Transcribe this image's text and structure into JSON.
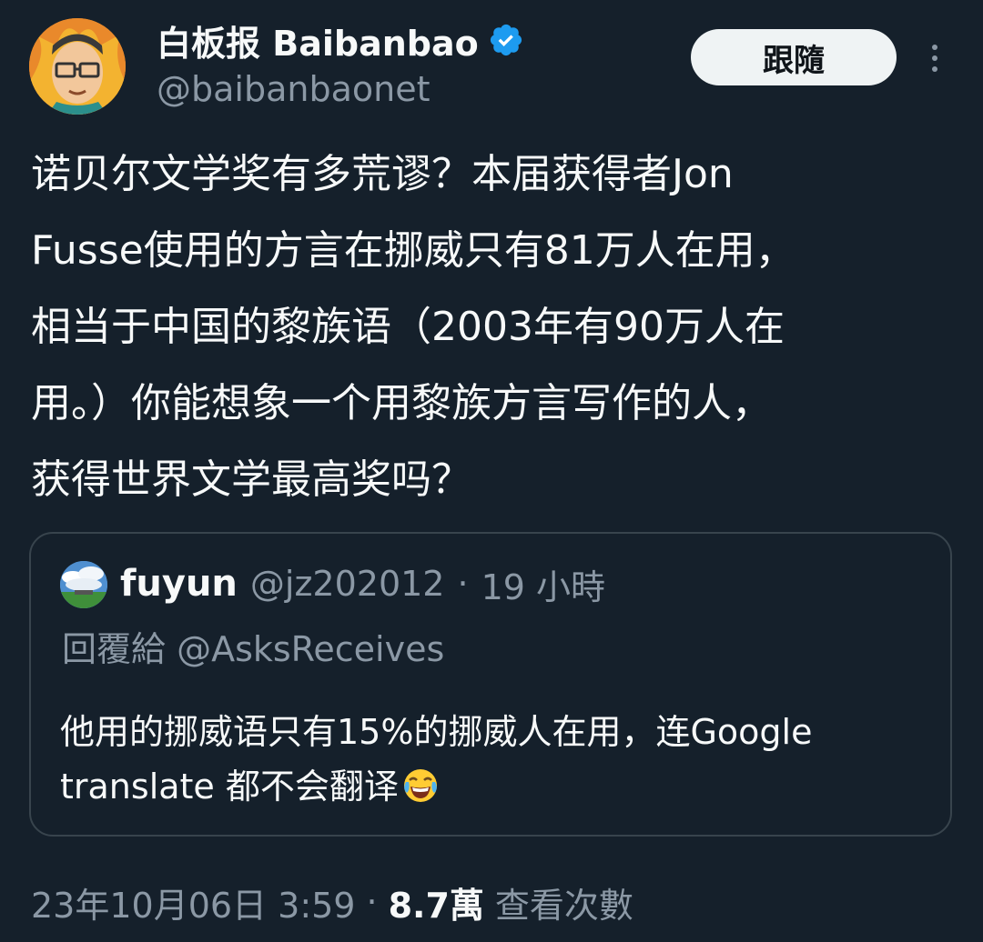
{
  "author": {
    "name": "白板报 Baibanbao",
    "handle": "@baibanbaonet",
    "verified": true,
    "accent_color": "#1d9bf0"
  },
  "actions": {
    "follow_label": "跟隨",
    "more_icon": "more-vertical-icon"
  },
  "tweet": {
    "lines": [
      "诺贝尔文学奖有多荒谬？本届获得者Jon",
      "Fusse使用的方言在挪威只有81万人在用，",
      "相当于中国的黎族语（2003年有90万人在",
      "用。）你能想象一个用黎族方言写作的人，",
      "获得世界文学最高奖吗？"
    ]
  },
  "quoted": {
    "name": "fuyun",
    "handle": "@jz202012",
    "separator": "·",
    "time": "19 小時",
    "reply_to": "回覆給 @AsksReceives",
    "text_lines": [
      "他用的挪威语只有15%的挪威人在用，连Google",
      "translate 都不会翻译"
    ],
    "emoji": "face-with-tears-of-joy-icon"
  },
  "footer": {
    "timestamp": "23年10月06日 3:59",
    "separator": "·",
    "views_count": "8.7萬",
    "views_label": "查看次數"
  },
  "colors": {
    "background": "#15202b",
    "text_primary": "#f7f9f9",
    "text_secondary": "#8b98a5",
    "border": "#38444d",
    "button_bg": "#eff3f4"
  }
}
